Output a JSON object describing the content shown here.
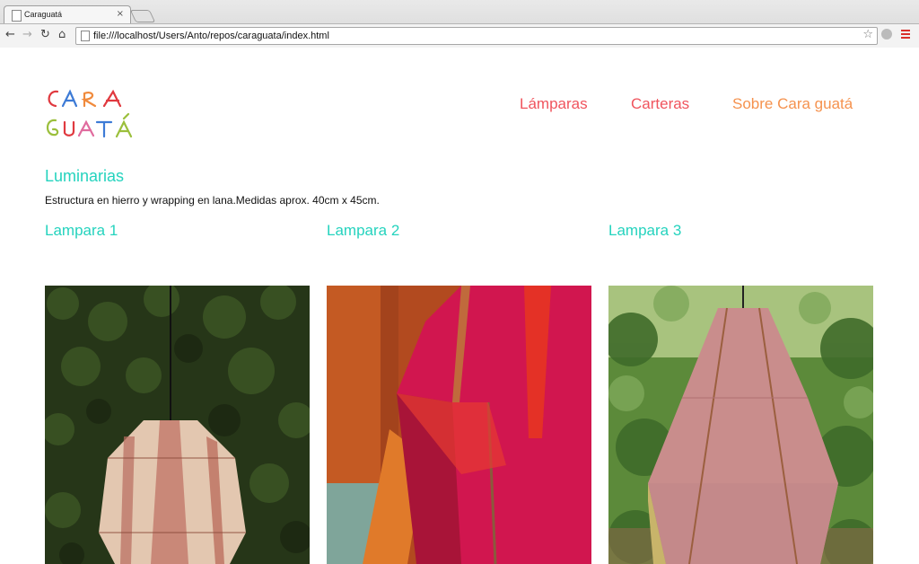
{
  "browser": {
    "tab_title": "Caraguatá",
    "tab_close": "×",
    "url": "file:///localhost/Users/Anto/repos/caraguata/index.html"
  },
  "site": {
    "logo_line1": "CARA",
    "logo_line2": "GUATÁ",
    "nav": [
      {
        "label": "Lámparas",
        "color": "#f0545d"
      },
      {
        "label": "Carteras",
        "color": "#f0545d"
      },
      {
        "label": "Sobre Cara guatá",
        "color": "#f5924e"
      }
    ]
  },
  "section": {
    "title": "Luminarias",
    "description": "Estructura en hierro y wrapping en lana.Medidas aprox. 40cm x 45cm."
  },
  "products": [
    {
      "title": "Lampara 1",
      "image": "lamp-photo-green-foliage"
    },
    {
      "title": "Lampara 2",
      "image": "lamp-photo-closeup-magenta"
    },
    {
      "title": "Lampara 3",
      "image": "lamp-photo-pink-trees"
    }
  ],
  "colors": {
    "accent_teal": "#25d3be",
    "nav_red": "#f0545d",
    "nav_orange": "#f5924e"
  }
}
